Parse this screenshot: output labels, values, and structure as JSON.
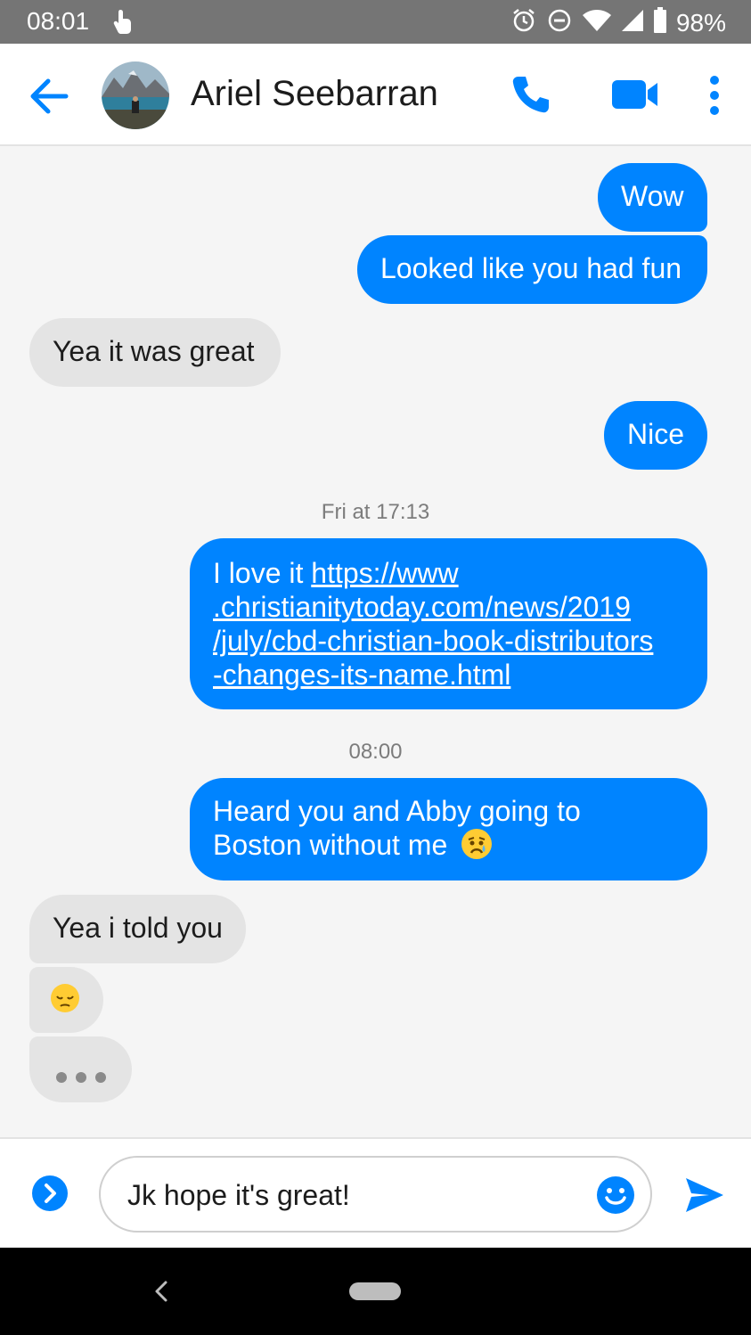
{
  "status_bar": {
    "time": "08:01",
    "battery_percent": "98%",
    "icons": [
      "touch-icon",
      "alarm-icon",
      "do-not-disturb-icon",
      "wifi-icon",
      "signal-icon",
      "battery-icon"
    ]
  },
  "header": {
    "contact_name": "Ariel Seebarran",
    "icons": [
      "back-arrow-icon",
      "phone-icon",
      "video-call-icon",
      "more-vert-icon"
    ]
  },
  "messages": [
    {
      "side": "out",
      "text": "Wow"
    },
    {
      "side": "out",
      "text": "Looked like you had fun"
    },
    {
      "side": "in",
      "text": "Yea it was great"
    },
    {
      "side": "out",
      "text": "Nice"
    },
    {
      "type": "timestamp",
      "text": "Fri at 17:13"
    },
    {
      "side": "out",
      "text_prefix": "I love it ",
      "link_lines": [
        "https://www",
        ".christianitytoday.com/news/2019",
        "/july/cbd-christian-book-distributors",
        "-changes-its-name.html"
      ]
    },
    {
      "type": "timestamp",
      "text": "08:00"
    },
    {
      "side": "out",
      "lines": [
        "Heard you and Abby going to",
        "Boston without me"
      ],
      "emoji": "crying-face-emoji"
    },
    {
      "side": "in",
      "text": "Yea i told you"
    },
    {
      "side": "in",
      "emoji": "pensive-face-emoji"
    },
    {
      "side": "in",
      "typing_indicator": "typing-dots-icon"
    }
  ],
  "composer": {
    "input_value": "Jk hope it's great!",
    "icons": [
      "expand-actions-icon",
      "emoji-icon",
      "send-icon"
    ]
  },
  "colors": {
    "accent": "#0084ff",
    "incoming_bubble": "#e4e4e4",
    "status_bar": "#757575",
    "background": "#f5f5f5"
  }
}
